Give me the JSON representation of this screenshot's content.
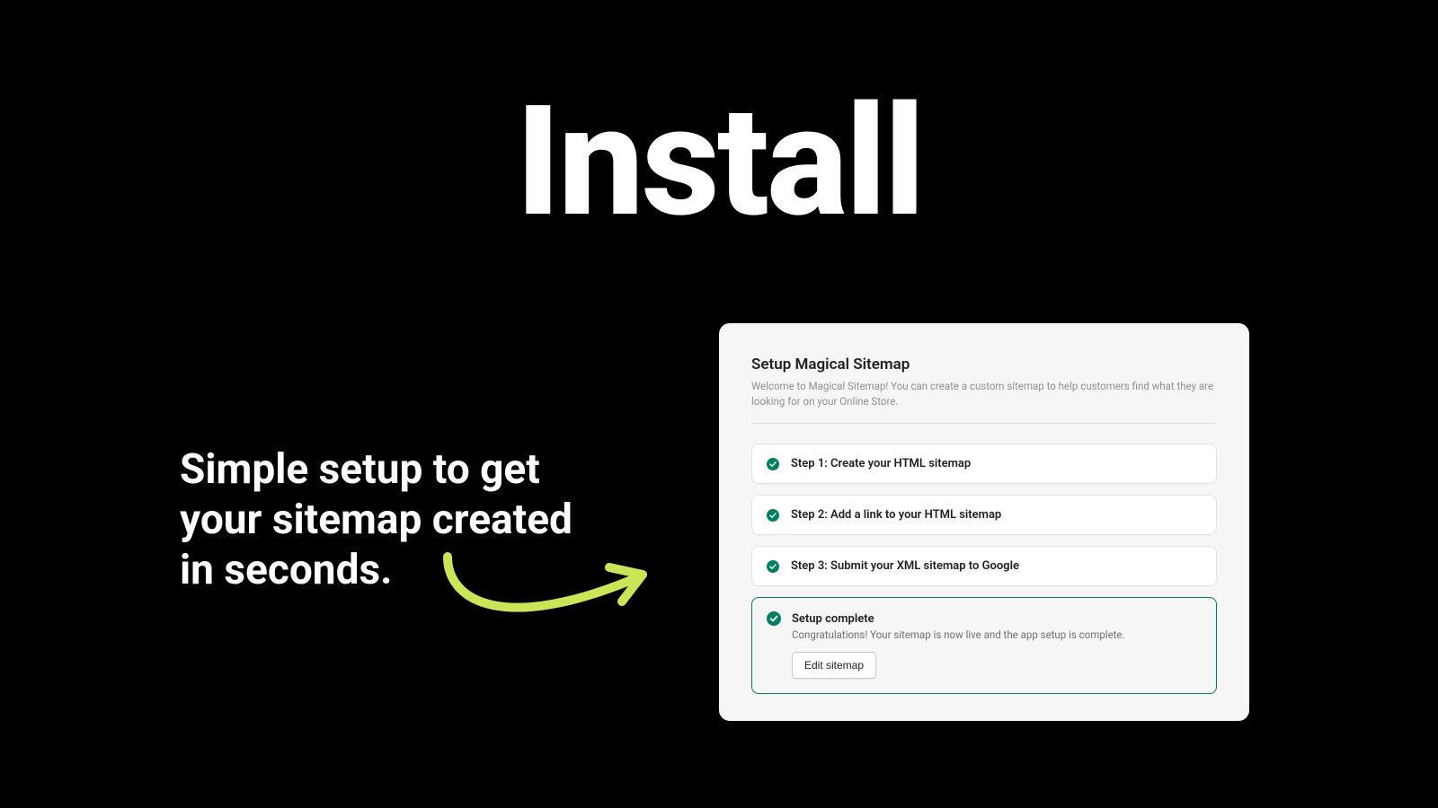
{
  "hero": {
    "title": "Install",
    "tagline": "Simple setup to get your sitemap created in seconds."
  },
  "panel": {
    "title": "Setup Magical Sitemap",
    "description": "Welcome to Magical Sitemap! You can create a custom sitemap to help customers find what they are looking for on your Online Store.",
    "steps": [
      {
        "label": "Step 1: Create your HTML sitemap"
      },
      {
        "label": "Step 2: Add a link to your HTML sitemap"
      },
      {
        "label": "Step 3: Submit your XML sitemap to Google"
      }
    ],
    "complete": {
      "title": "Setup complete",
      "description": "Congratulations! Your sitemap is now live and the app setup is complete.",
      "button": "Edit sitemap"
    }
  },
  "colors": {
    "accent": "#008060",
    "arrow": "#c8e657"
  }
}
